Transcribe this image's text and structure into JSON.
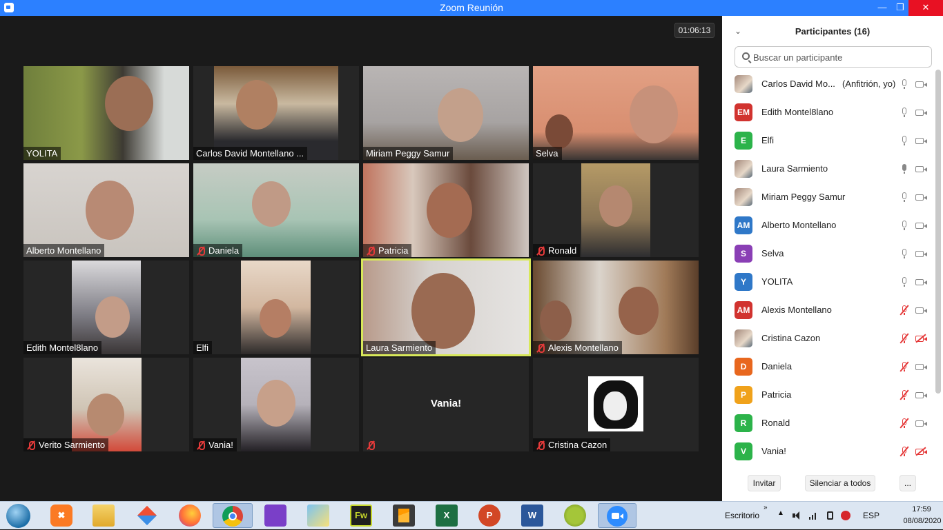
{
  "window": {
    "title": "Zoom Reunión"
  },
  "meeting": {
    "timer": "01:06:13",
    "tiles": [
      {
        "name": "YOLITA",
        "muted": false
      },
      {
        "name": "Carlos David Montellano ...",
        "muted": false
      },
      {
        "name": "Miriam Peggy Samur",
        "muted": false
      },
      {
        "name": "Selva",
        "muted": false
      },
      {
        "name": "Alberto Montellano",
        "muted": false
      },
      {
        "name": "Daniela",
        "muted": true
      },
      {
        "name": "Patricia",
        "muted": true
      },
      {
        "name": "Ronald",
        "muted": true
      },
      {
        "name": "Edith Montel8lano",
        "muted": false
      },
      {
        "name": "Elfi",
        "muted": false
      },
      {
        "name": "Laura Sarmiento",
        "muted": false,
        "active": true
      },
      {
        "name": "Alexis Montellano",
        "muted": true
      },
      {
        "name": "Verito Sarmiento",
        "muted": true
      },
      {
        "name": "Vania!",
        "muted": true
      },
      {
        "name": "",
        "muted": true,
        "center_name": "Vania!"
      },
      {
        "name": "Cristina Cazon",
        "muted": true
      }
    ]
  },
  "participants": {
    "title": "Participantes (16)",
    "search_placeholder": "Buscar un participante",
    "list": [
      {
        "name": "Carlos David Mo...",
        "role": "(Anfitrión, yo)",
        "avatar_type": "photo",
        "mic_off": false,
        "cam_off": false
      },
      {
        "name": "Edith Montel8lano",
        "initials": "EM",
        "color": "#d1332f",
        "mic_off": false,
        "cam_off": false
      },
      {
        "name": "Elfi",
        "initials": "E",
        "color": "#2cb34a",
        "mic_off": false,
        "cam_off": false
      },
      {
        "name": "Laura Sarmiento",
        "avatar_type": "photo",
        "mic_off": false,
        "mic_active": true,
        "cam_off": false
      },
      {
        "name": "Miriam Peggy Samur",
        "avatar_type": "photo",
        "mic_off": false,
        "cam_off": false
      },
      {
        "name": "Alberto Montellano",
        "initials": "AM",
        "color": "#2f78c8",
        "mic_off": false,
        "cam_off": false
      },
      {
        "name": "Selva",
        "initials": "S",
        "color": "#8a3fb5",
        "mic_off": false,
        "cam_off": false
      },
      {
        "name": "YOLITA",
        "initials": "Y",
        "color": "#2f78c8",
        "mic_off": false,
        "cam_off": false
      },
      {
        "name": "Alexis Montellano",
        "initials": "AM",
        "color": "#d1332f",
        "mic_off": true,
        "cam_off": false
      },
      {
        "name": "Cristina Cazon",
        "avatar_type": "photo",
        "mic_off": true,
        "cam_off": true
      },
      {
        "name": "Daniela",
        "initials": "D",
        "color": "#e8671e",
        "mic_off": true,
        "cam_off": false
      },
      {
        "name": "Patricia",
        "initials": "P",
        "color": "#f0a21b",
        "mic_off": true,
        "cam_off": false
      },
      {
        "name": "Ronald",
        "initials": "R",
        "color": "#2cb34a",
        "mic_off": true,
        "cam_off": false
      },
      {
        "name": "Vania!",
        "initials": "V",
        "color": "#2cb34a",
        "mic_off": true,
        "cam_off": true
      }
    ],
    "footer": {
      "invite": "Invitar",
      "mute_all": "Silenciar a todos",
      "more": "..."
    }
  },
  "taskbar": {
    "apps": [
      "start-orb",
      "xampp",
      "file-explorer",
      "git-app",
      "firefox",
      "chrome",
      "visual-studio",
      "notes-app",
      "fireworks",
      "sublime-text",
      "excel",
      "powerpoint",
      "word",
      "android-studio",
      "zoom"
    ],
    "fireworks_label": "Fw",
    "desktop_label": "Escritorio",
    "chevron": "»",
    "up_arrow": "▲",
    "language": "ESP",
    "time": "17:59",
    "date": "08/08/2020"
  }
}
